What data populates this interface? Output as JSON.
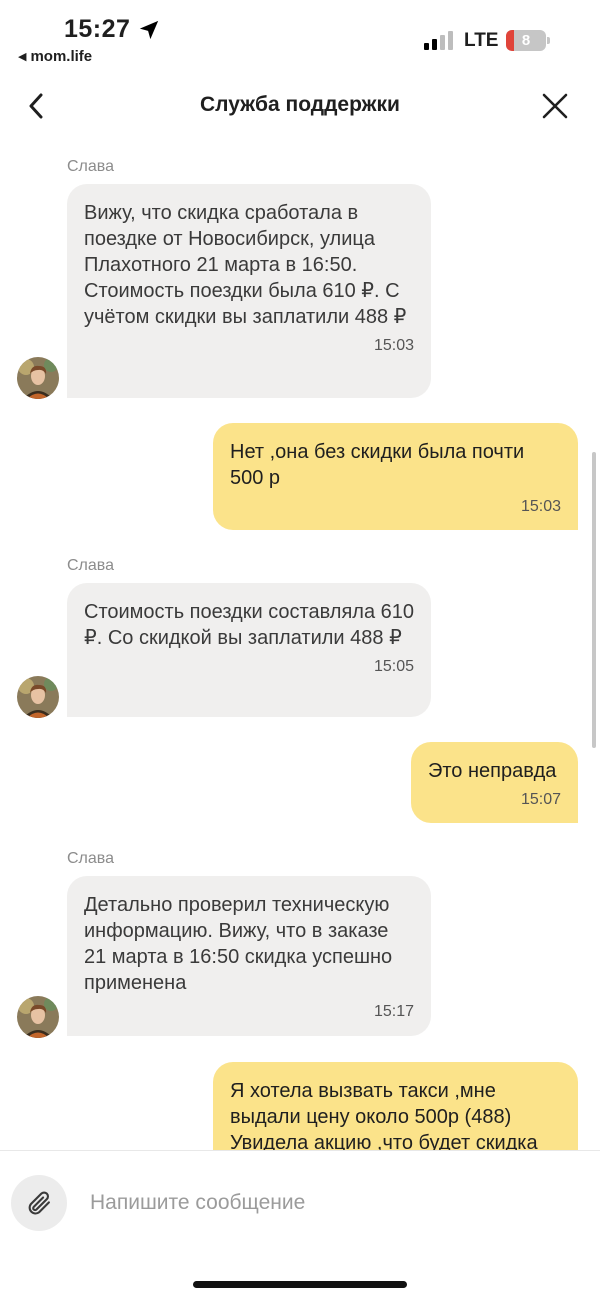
{
  "status_bar": {
    "time": "15:27",
    "back_app": "mom.life",
    "network": "LTE",
    "battery": "8"
  },
  "header": {
    "title": "Служба поддержки",
    "back_icon": "chevron-left-icon",
    "close_icon": "close-icon"
  },
  "messages": [
    {
      "sender": "Слава",
      "text": "Вижу, что скидка сработала в поездке от Новосибирск, улица Плахотного 21 марта в 16:50. Стоимость поездки была 610 ₽. С учётом скидки вы заплатили 488 ₽",
      "time": "15:03"
    },
    {
      "text": "Нет ,она без скидки была почти 500 р",
      "time": "15:03"
    },
    {
      "sender": "Слава",
      "text": "Стоимость поездки составляла 610 ₽. Со скидкой вы заплатили 488 ₽",
      "time": "15:05"
    },
    {
      "text": "Это неправда",
      "time": "15:07"
    },
    {
      "sender": "Слава",
      "text": "Детально проверил техническую информацию. Вижу, что в заказе 21 марта в 16:50 скидка успешно применена",
      "time": "15:17"
    },
    {
      "text": "Я хотела вызвать такси ,мне выдали цену около 500р (488)\nУвидела акцию ,что будет скидка"
    }
  ],
  "composer": {
    "placeholder": "Напишите сообщение",
    "attach_icon": "paperclip-icon"
  },
  "colors": {
    "incoming_bubble": "#f0efee",
    "outgoing_bubble": "#fbe38a"
  }
}
